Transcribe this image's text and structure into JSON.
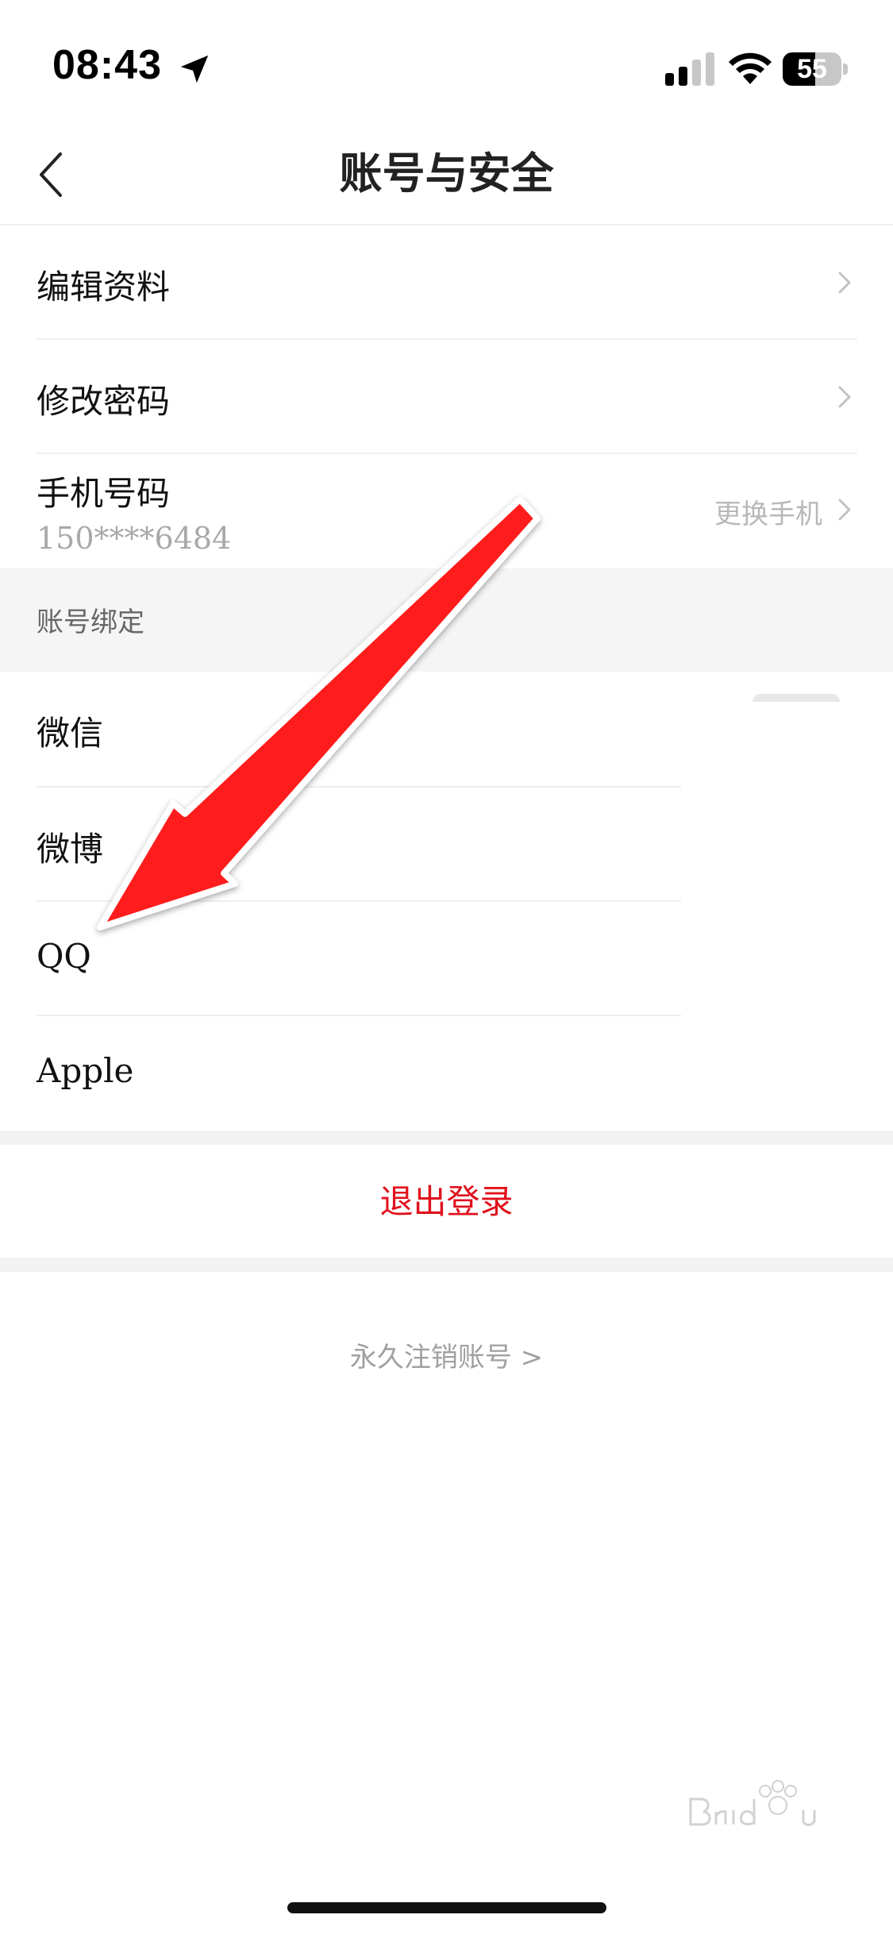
{
  "status_bar": {
    "time": "08:43",
    "battery": "55",
    "battery_level": 0.55
  },
  "nav": {
    "title": "账号与安全"
  },
  "menu": {
    "edit_profile": "编辑资料",
    "change_password": "修改密码",
    "phone_label": "手机号码",
    "phone_number": "150****6484",
    "change_phone": "更换手机"
  },
  "binding": {
    "section_title": "账号绑定",
    "items": [
      "微信",
      "微博",
      "QQ",
      "Apple"
    ]
  },
  "actions": {
    "logout": "退出登录",
    "delete_account": "永久注销账号 >"
  },
  "colors": {
    "accent_red": "#e0101c",
    "annotation_arrow": "#ff1a1a"
  },
  "icons": {
    "back": "chevron-left-icon",
    "chevron": "chevron-right-icon",
    "location": "location-arrow-icon",
    "signal": "cellular-signal-icon",
    "wifi": "wifi-icon",
    "battery": "battery-icon",
    "annotation": "red-arrow-annotation-icon",
    "watermark": "baidu-watermark-icon"
  }
}
